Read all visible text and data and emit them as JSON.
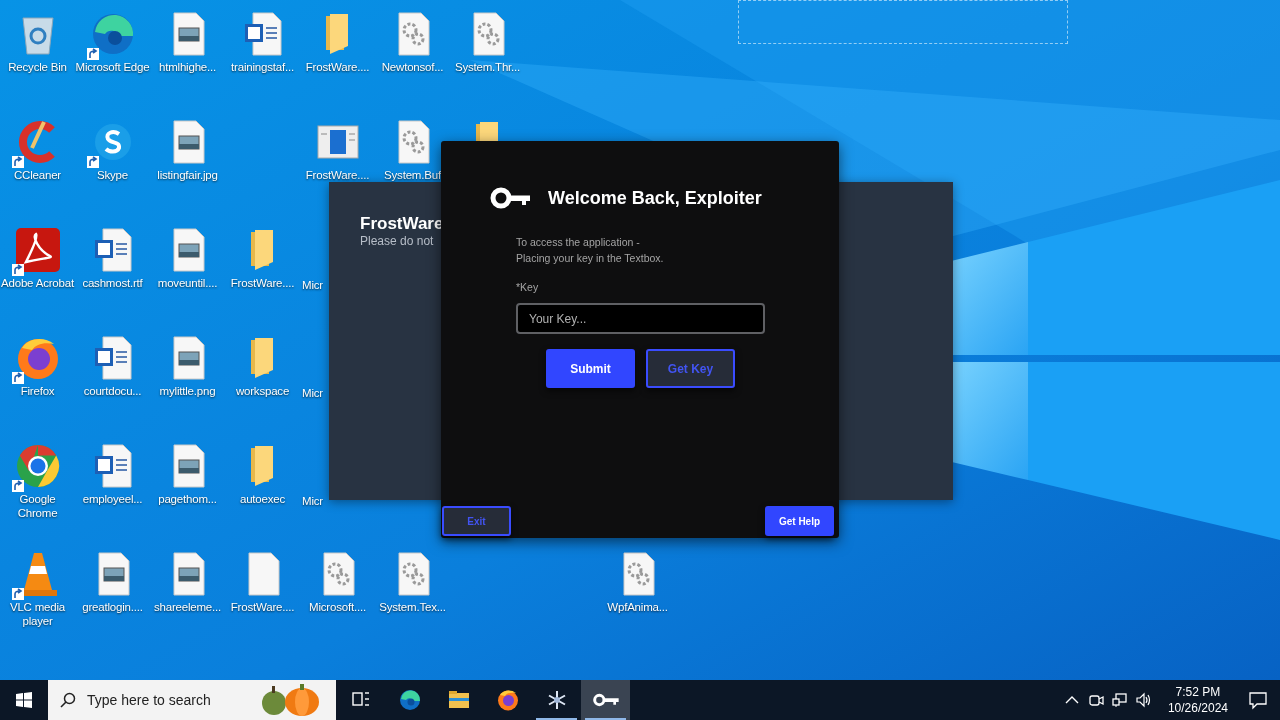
{
  "desktop": {
    "rows": [
      [
        {
          "kind": "recycle",
          "label": "Recycle Bin",
          "shortcut": false
        },
        {
          "kind": "edge",
          "label": "Microsoft Edge",
          "shortcut": true
        },
        {
          "kind": "image",
          "label": "htmlhighe...",
          "shortcut": false
        },
        {
          "kind": "word",
          "label": "trainingstaf...",
          "shortcut": false
        },
        {
          "kind": "folder",
          "label": "FrostWare....",
          "shortcut": false
        },
        {
          "kind": "settings",
          "label": "Newtonsof...",
          "shortcut": false
        },
        {
          "kind": "settings",
          "label": "System.Thr...",
          "shortcut": false
        },
        {
          "kind": "empty"
        },
        {
          "kind": "empty"
        }
      ],
      [
        {
          "kind": "ccleaner",
          "label": "CCleaner",
          "shortcut": true
        },
        {
          "kind": "skype",
          "label": "Skype",
          "shortcut": true
        },
        {
          "kind": "image",
          "label": "listingfair.jpg",
          "shortcut": false
        },
        {
          "kind": "empty"
        },
        {
          "kind": "app",
          "label": "FrostWare....",
          "shortcut": false
        },
        {
          "kind": "settings",
          "label": "System.Buf",
          "shortcut": false
        },
        {
          "kind": "folder"
        },
        {
          "kind": "empty"
        },
        {
          "kind": "empty"
        }
      ],
      [
        {
          "kind": "pdf",
          "label": "Adobe Acrobat",
          "shortcut": true
        },
        {
          "kind": "word",
          "label": "cashmost.rtf",
          "shortcut": false
        },
        {
          "kind": "image",
          "label": "moveuntil....",
          "shortcut": false
        },
        {
          "kind": "folder",
          "label": "FrostWare....",
          "shortcut": false
        },
        {
          "kind": "covered",
          "label": "Micr"
        },
        {
          "kind": "empty"
        },
        {
          "kind": "empty"
        },
        {
          "kind": "empty"
        },
        {
          "kind": "empty"
        }
      ],
      [
        {
          "kind": "firefox",
          "label": "Firefox",
          "shortcut": true
        },
        {
          "kind": "word",
          "label": "courtdocu...",
          "shortcut": false
        },
        {
          "kind": "image",
          "label": "mylittle.png",
          "shortcut": false
        },
        {
          "kind": "folder",
          "label": "workspace",
          "shortcut": false
        },
        {
          "kind": "covered",
          "label": "Micr"
        },
        {
          "kind": "empty"
        },
        {
          "kind": "empty"
        },
        {
          "kind": "empty"
        },
        {
          "kind": "empty"
        }
      ],
      [
        {
          "kind": "chrome",
          "label": "Google Chrome",
          "shortcut": true
        },
        {
          "kind": "word",
          "label": "employeel...",
          "shortcut": false
        },
        {
          "kind": "image",
          "label": "pagethom...",
          "shortcut": false
        },
        {
          "kind": "folder",
          "label": "autoexec",
          "shortcut": false
        },
        {
          "kind": "covered",
          "label": "Micr"
        },
        {
          "kind": "empty"
        },
        {
          "kind": "empty"
        },
        {
          "kind": "empty"
        },
        {
          "kind": "empty"
        }
      ],
      [
        {
          "kind": "vlc",
          "label": "VLC media player",
          "shortcut": true
        },
        {
          "kind": "image",
          "label": "greatlogin....",
          "shortcut": false
        },
        {
          "kind": "image",
          "label": "shareeleme...",
          "shortcut": false
        },
        {
          "kind": "blank",
          "label": "FrostWare....",
          "shortcut": false
        },
        {
          "kind": "settings",
          "label": "Microsoft....",
          "shortcut": false
        },
        {
          "kind": "settings",
          "label": "System.Tex...",
          "shortcut": false
        },
        {
          "kind": "empty"
        },
        {
          "kind": "empty"
        },
        {
          "kind": "settings",
          "label": "WpfAnima...",
          "shortcut": false
        }
      ]
    ]
  },
  "back_window": {
    "title": "FrostWare",
    "subtitle": "Please do not"
  },
  "dialog": {
    "title": "Welcome Back, Exploiter",
    "instructions": [
      "To access the application -",
      "Placing your key in the Textbox."
    ],
    "field_label": "*Key",
    "key_field": {
      "placeholder": "Your Key..."
    },
    "buttons": [
      {
        "label": "Submit",
        "kind": "primary"
      },
      {
        "label": "Get Key",
        "kind": "outline"
      }
    ],
    "footer": [
      {
        "label": "Exit",
        "kind": "outline"
      },
      {
        "label": "Get Help",
        "kind": "primary"
      }
    ]
  },
  "taskbar": {
    "search": {
      "placeholder": "Type here to search"
    },
    "apps": [
      {
        "kind": "task-view",
        "running": false,
        "active": false
      },
      {
        "kind": "edge",
        "running": false,
        "active": false
      },
      {
        "kind": "explorer",
        "running": false,
        "active": false
      },
      {
        "kind": "firefox",
        "running": false,
        "active": false
      },
      {
        "kind": "snowflake",
        "running": true,
        "active": false
      },
      {
        "kind": "key",
        "running": true,
        "active": true
      }
    ],
    "clock": {
      "time": "7:52 PM",
      "date": "10/26/2024"
    }
  }
}
